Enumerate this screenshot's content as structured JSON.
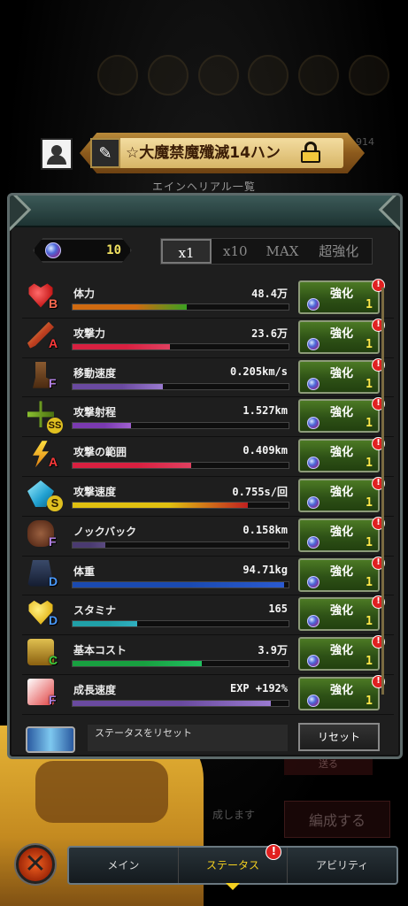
{
  "header": {
    "title": "☆大魔禁魔殲滅14ハン",
    "subtitle": "エインヘリアル一覧",
    "bg_number": "914"
  },
  "currency": {
    "crystals": "10"
  },
  "multiplier": {
    "options": [
      "x1",
      "x10",
      "MAX",
      "超強化"
    ],
    "active": "x1"
  },
  "upgrade_button": {
    "label": "強化",
    "cost": "1",
    "alert": "!"
  },
  "stats": [
    {
      "name": "体力",
      "grade": "B",
      "value": "48.4万",
      "icon": "heart-icon",
      "fill": 0.53,
      "colors": [
        "#d06a10",
        "#3aa020"
      ]
    },
    {
      "name": "攻撃力",
      "grade": "A",
      "value": "23.6万",
      "icon": "sword-icon",
      "fill": 0.45,
      "colors": [
        "#d82040",
        "#e04060"
      ]
    },
    {
      "name": "移動速度",
      "grade": "F",
      "value": "0.205km/s",
      "icon": "boot-icon",
      "fill": 0.42,
      "colors": [
        "#6a4aa0",
        "#9a7ad0"
      ]
    },
    {
      "name": "攻撃射程",
      "grade": "SS",
      "value": "1.527km",
      "icon": "crossbow-icon",
      "fill": 0.27,
      "colors": [
        "#7a3ab0",
        "#a060d0"
      ]
    },
    {
      "name": "攻撃の範囲",
      "grade": "A",
      "value": "0.409km",
      "icon": "lightning-icon",
      "fill": 0.55,
      "colors": [
        "#d82040",
        "#e04060"
      ]
    },
    {
      "name": "攻撃速度",
      "grade": "S",
      "value": "0.755s/回",
      "icon": "crystal-icon",
      "fill": 0.81,
      "colors": [
        "#e0c010",
        "#c02020"
      ]
    },
    {
      "name": "ノックバック",
      "grade": "F",
      "value": "0.158km",
      "icon": "gauntlet-icon",
      "fill": 0.15,
      "colors": [
        "#4a3a70",
        "#5a4a80"
      ]
    },
    {
      "name": "体重",
      "grade": "D",
      "value": "94.71kg",
      "icon": "weight-icon",
      "fill": 0.98,
      "colors": [
        "#1a4ab0",
        "#2a5ad0"
      ]
    },
    {
      "name": "スタミナ",
      "grade": "D",
      "value": "165",
      "icon": "stamina-heart-icon",
      "fill": 0.3,
      "colors": [
        "#20a0a8",
        "#30b0c0"
      ]
    },
    {
      "name": "基本コスト",
      "grade": "C",
      "value": "3.9万",
      "icon": "cost-icon",
      "fill": 0.6,
      "colors": [
        "#18a040",
        "#20c060"
      ]
    },
    {
      "name": "成長速度",
      "grade": "F",
      "value": "EXP +192%",
      "icon": "growth-chart-icon",
      "fill": 0.92,
      "colors": [
        "#6a4aa0",
        "#9a7ad0"
      ]
    }
  ],
  "reset": {
    "label": "ステータスをリセット",
    "button": "リセット"
  },
  "background": {
    "formation_button": "編成する",
    "text": "成します",
    "small_btn": "送る"
  },
  "nav": {
    "tabs": [
      "メイン",
      "ステータス",
      "アビリティ"
    ],
    "active": "ステータス",
    "alert": "!"
  },
  "grade_colors": {
    "SS": "#e0c020",
    "S": "#e0c020",
    "A": "#ff3a3a",
    "B": "#ff6a50",
    "C": "#40d040",
    "D": "#4a9aff",
    "F": "#b080e0"
  }
}
